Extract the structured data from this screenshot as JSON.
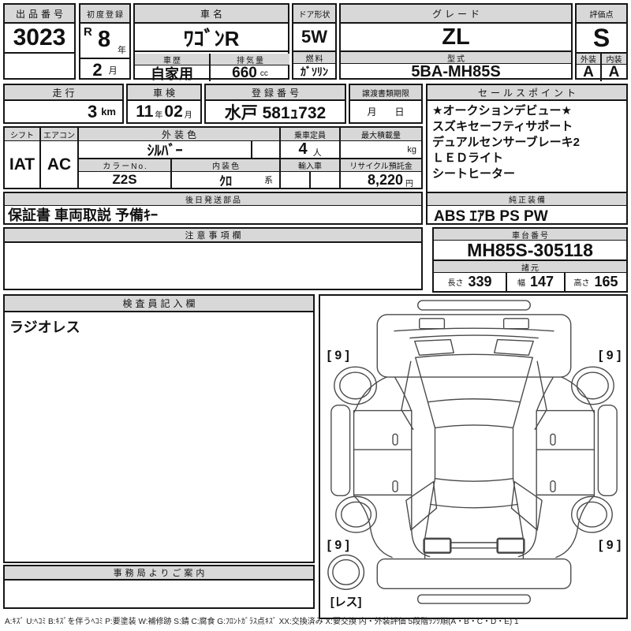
{
  "sheet": {
    "auction": {
      "label": "出品番号",
      "value": "3023"
    },
    "first_reg": {
      "label": "初度登録",
      "era": "R",
      "year": "8",
      "year_unit": "年",
      "month": "2",
      "month_unit": "月"
    },
    "car_name": {
      "label": "車名",
      "value": "ﾜｺﾞﾝR"
    },
    "door": {
      "label": "ドア形状",
      "value": "5W"
    },
    "grade": {
      "label": "グレード",
      "value": "ZL"
    },
    "score": {
      "label": "評価点",
      "value": "S"
    },
    "history": {
      "label": "車歴",
      "value": "自家用"
    },
    "displacement": {
      "label": "排気量",
      "value": "660",
      "unit": "cc"
    },
    "fuel": {
      "label": "燃料",
      "value": "ｶﾞｿﾘﾝ"
    },
    "model": {
      "label": "型式",
      "value": "5BA-MH85S"
    },
    "exterior": {
      "label": "外装",
      "value": "A"
    },
    "interior": {
      "label": "内装",
      "value": "A"
    },
    "mileage": {
      "label": "走行",
      "value": "3",
      "unit": "km"
    },
    "shaken": {
      "label": "車検",
      "year": "11",
      "year_unit": "年",
      "month": "02",
      "month_unit": "月"
    },
    "reg_no": {
      "label": "登録番号",
      "value": "水戸 581ｭ732"
    },
    "transfer": {
      "label": "譲渡書類期限",
      "month": "月",
      "day": "日"
    },
    "shift": {
      "label": "シフト",
      "value": "IAT"
    },
    "aircon": {
      "label": "エアコン",
      "value": "AC"
    },
    "ext_color": {
      "label": "外装色",
      "value": "ｼﾙﾊﾞｰ"
    },
    "capacity": {
      "label": "乗車定員",
      "value": "4",
      "unit": "人"
    },
    "max_load": {
      "label": "最大積載量",
      "unit": "kg"
    },
    "color_no": {
      "label": "カラーNo.",
      "value": "Z2S"
    },
    "int_color": {
      "label": "内装色",
      "value": "ｸﾛ",
      "suffix": "系"
    },
    "import_car": {
      "label": "輸入車",
      "value": ""
    },
    "recycle": {
      "label": "リサイクル預託金",
      "value": "8,220",
      "unit": "円"
    },
    "later_parts": {
      "label": "後日発送部品",
      "value": "保証書 車両取説 予備ｷｰ"
    },
    "sales_points": {
      "label": "セールスポイント",
      "lines": [
        "★オークションデビュー★",
        "スズキセーフティサポート",
        "デュアルセンサーブレーキ2",
        "ＬＥＤライト",
        "シートヒーター"
      ]
    },
    "oem": {
      "label": "純正装備",
      "value": "ABS ｴｱB PS PW"
    },
    "notes": {
      "label": "注意事項欄",
      "value": ""
    },
    "chassis": {
      "label": "車台番号",
      "value": "MH85S-305118"
    },
    "dims": {
      "label": "諸元",
      "length_label": "長さ",
      "length": "339",
      "width_label": "幅",
      "width": "147",
      "height_label": "高さ",
      "height": "165"
    },
    "inspector": {
      "label": "検査員記入欄",
      "note": "ラジオレス"
    },
    "office": {
      "label": "事務局よりご案内",
      "value": ""
    },
    "diagram": {
      "tire_fl": "[ 9 ]",
      "tire_fr": "[ 9 ]",
      "tire_rl": "[ 9 ]",
      "tire_rr": "[ 9 ]",
      "spare": "[レス]"
    },
    "legend": "A:ｷｽﾞ U:ﾍｺﾐ B:ｷｽﾞを伴うﾍｺﾐ P:要塗装 W:補修跡 S:錆 C:腐食 G:ﾌﾛﾝﾄｶﾞﾗｽ点ｷｽﾞ XX:交換済み X:要交換  内・外装評価 5段階ﾗﾝｸ順(A・B・C・D・E) 1"
  }
}
